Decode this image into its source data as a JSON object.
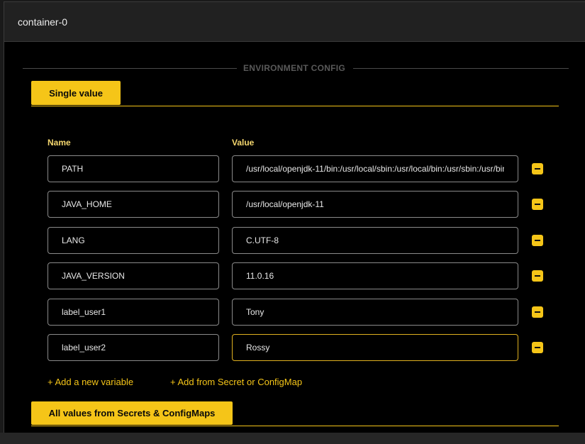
{
  "container": {
    "title": "container-0"
  },
  "section": {
    "title": "ENVIRONMENT CONFIG"
  },
  "tabs": {
    "single_value": "Single value",
    "all_values": "All values from Secrets & ConfigMaps"
  },
  "columns": {
    "name": "Name",
    "value": "Value"
  },
  "variables": [
    {
      "name": "PATH",
      "value": "/usr/local/openjdk-11/bin:/usr/local/sbin:/usr/local/bin:/usr/sbin:/usr/bin"
    },
    {
      "name": "JAVA_HOME",
      "value": "/usr/local/openjdk-11"
    },
    {
      "name": "LANG",
      "value": "C.UTF-8"
    },
    {
      "name": "JAVA_VERSION",
      "value": "11.0.16"
    },
    {
      "name": "label_user1",
      "value": "Tony"
    },
    {
      "name": "label_user2",
      "value": "Rossy"
    }
  ],
  "actions": {
    "add_variable": "+ Add a new variable",
    "add_from_secret": "+ Add from Secret or ConfigMap"
  },
  "colors": {
    "accent": "#f5c518",
    "label": "#f5d76e",
    "background": "#000000",
    "header": "#212121"
  },
  "icons": {
    "remove": "minus-icon"
  }
}
